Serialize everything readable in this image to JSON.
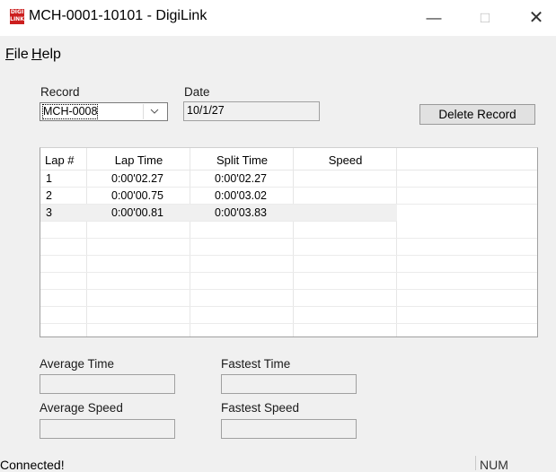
{
  "window": {
    "title": "MCH-0001-10101 - DigiLink",
    "icon_text": "DIGI LINK",
    "minimize_glyph": "—",
    "maximize_glyph": "□",
    "close_glyph": "✕"
  },
  "menu": {
    "file": "File",
    "help": "Help"
  },
  "record": {
    "label": "Record",
    "value": "MCH-0008"
  },
  "date": {
    "label": "Date",
    "value": "10/1/27"
  },
  "delete_button": "Delete Record",
  "table": {
    "columns": [
      "Lap #",
      "Lap Time",
      "Split Time",
      "Speed"
    ],
    "rows": [
      {
        "lap": "1",
        "lap_time": "0:00'02.27",
        "split_time": "0:00'02.27",
        "speed": ""
      },
      {
        "lap": "2",
        "lap_time": "0:00'00.75",
        "split_time": "0:00'03.02",
        "speed": ""
      },
      {
        "lap": "3",
        "lap_time": "0:00'00.81",
        "split_time": "0:00'03.83",
        "speed": ""
      }
    ],
    "selected_row": 3
  },
  "stats": {
    "average_time_label": "Average Time",
    "average_time_value": "",
    "fastest_time_label": "Fastest Time",
    "fastest_time_value": "",
    "average_speed_label": "Average Speed",
    "average_speed_value": "",
    "fastest_speed_label": "Fastest Speed",
    "fastest_speed_value": ""
  },
  "status": {
    "text": "Connected!",
    "num": "NUM"
  },
  "colors": {
    "window_bg": "#f0f0f0",
    "icon_red": "#cc1f1f",
    "selected_row": "#f0f0f0"
  }
}
